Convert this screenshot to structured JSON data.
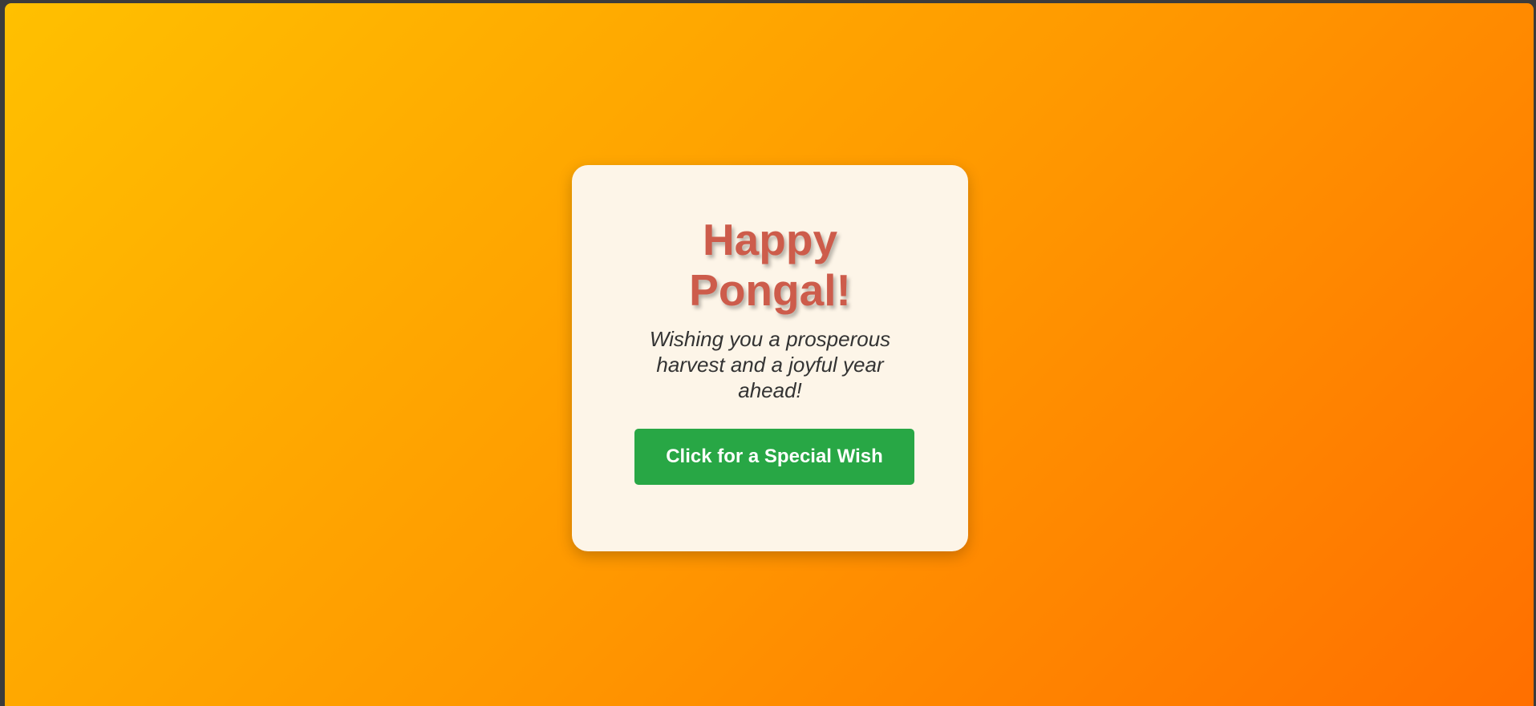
{
  "greeting_card": {
    "title_lines": [
      "Happy",
      "Pongal!"
    ],
    "message_lines": [
      "Wishing you a prosperous",
      "harvest and a joyful year",
      "ahead!"
    ],
    "button_label": "Click for a Special Wish"
  },
  "colors": {
    "background_gradient_start": "#ffc000",
    "background_gradient_end": "#ff6f00",
    "card_background": "#fdf5e8",
    "title_color": "#cd5c4b",
    "message_color": "#333333",
    "button_color": "#28a745",
    "button_text_color": "#ffffff"
  }
}
